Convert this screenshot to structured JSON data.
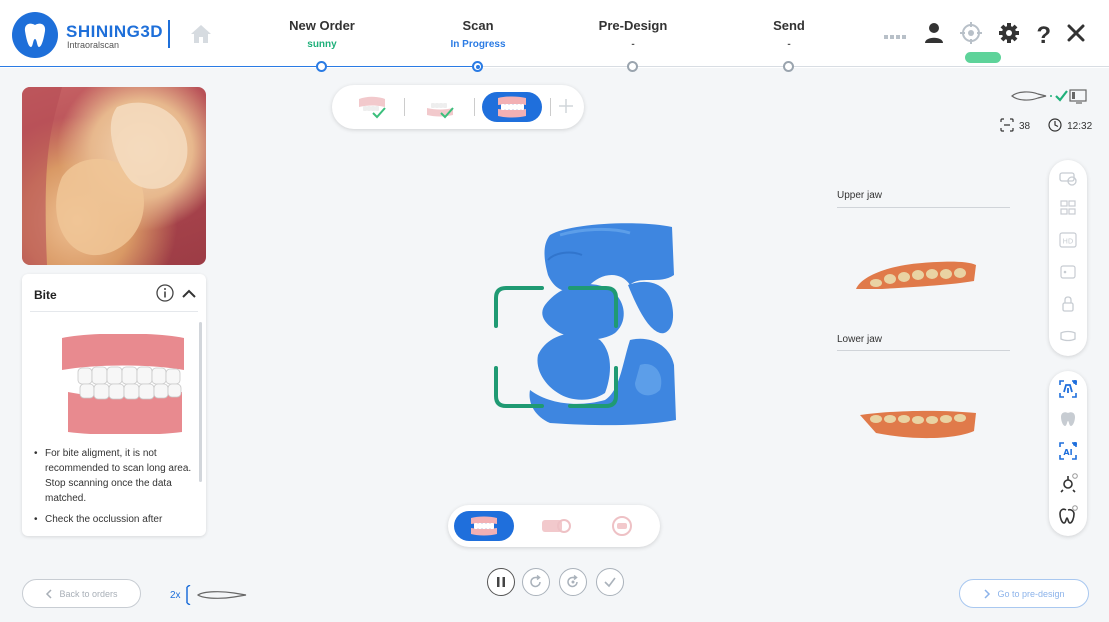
{
  "brand": {
    "name": "SHINING3D",
    "sub": "Intraoralscan"
  },
  "steps": [
    {
      "name": "New Order",
      "sub": "sunny",
      "sub_color": "#1fb07a"
    },
    {
      "name": "Scan",
      "sub": "In Progress",
      "sub_color": "#2a7be4"
    },
    {
      "name": "Pre-Design",
      "sub": "-",
      "sub_color": "#555555"
    },
    {
      "name": "Send",
      "sub": "-",
      "sub_color": "#555555"
    }
  ],
  "header": {
    "badge": ""
  },
  "status": {
    "count": "38",
    "time": "12:32"
  },
  "bite": {
    "title": "Bite",
    "tips": [
      "For bite aligment, it is not recommended to scan long area. Stop scanning once the data matched.",
      "Check the occlussion after"
    ]
  },
  "jaws": {
    "upper": "Upper jaw",
    "lower": "Lower jaw"
  },
  "scan_multiplier": "2x",
  "buttons": {
    "back": "Back to orders",
    "go": "Go to pre-design"
  },
  "colors": {
    "brand": "#1e6fd9",
    "accent_green": "#1fb07a",
    "scan_blue": "#3e86e0",
    "frame_green": "#1f9a73"
  }
}
